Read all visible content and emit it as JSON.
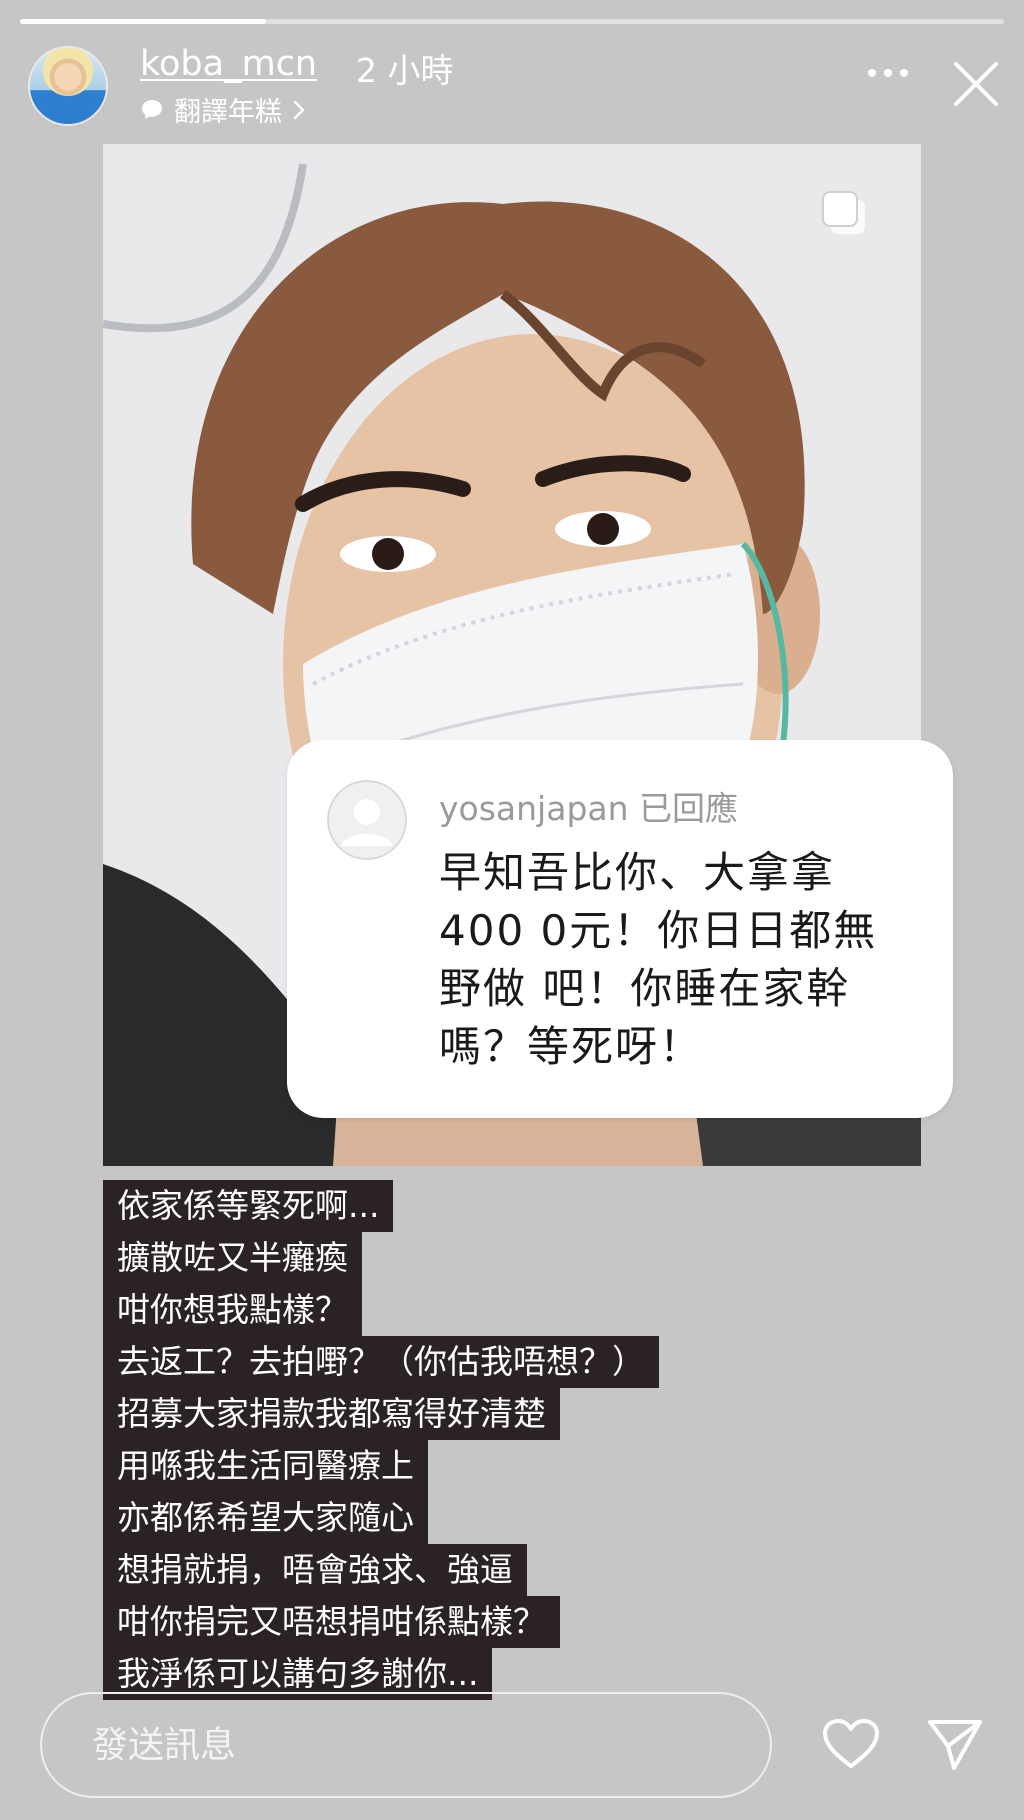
{
  "story": {
    "progress": 0.25,
    "username": "koba_mcn",
    "time_ago": "2 小時",
    "subtitle": "翻譯年糕"
  },
  "reply": {
    "header": "yosanjapan 已回應",
    "text": "早知吾比你、大拿拿400 0元！你日日都無野做 吧！你睡在家幹嗎？等死呀！"
  },
  "caption": [
    "依家係等緊死啊...",
    "擴散咗又半癱瘓",
    "咁你想我點樣？",
    "去返工？去拍嘢？（你估我唔想？）",
    "招募大家捐款我都寫得好清楚",
    "用喺我生活同醫療上",
    "亦都係希望大家隨心",
    "想捐就捐，唔會強求、強逼",
    "咁你捐完又唔想捐咁係點樣？",
    "我淨係可以講句多謝你..."
  ],
  "composer": {
    "placeholder": "發送訊息"
  },
  "icons": {
    "more": "more-icon",
    "close": "close-icon",
    "copy": "copy-icon",
    "heart": "heart-icon",
    "send": "send-icon"
  }
}
